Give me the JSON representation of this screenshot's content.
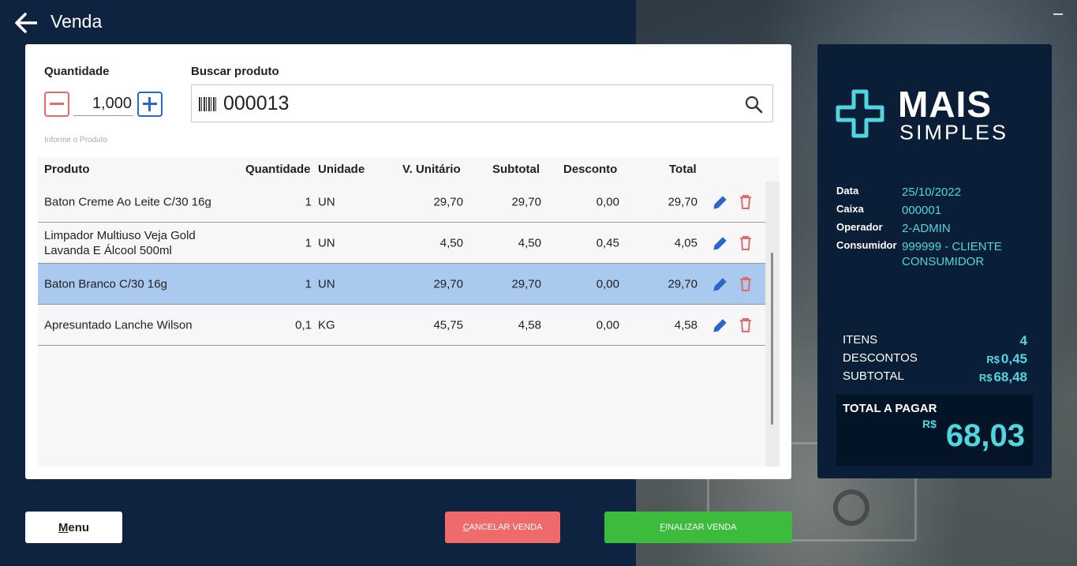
{
  "header": {
    "title": "Venda"
  },
  "quantity": {
    "label": "Quantidade",
    "value": "1,000"
  },
  "search": {
    "label": "Buscar produto",
    "value": "000013",
    "hint": "Informe o Produto"
  },
  "table": {
    "columns": [
      "Produto",
      "Quantidade",
      "Unidade",
      "V. Unitário",
      "Subtotal",
      "Desconto",
      "Total"
    ],
    "rows": [
      {
        "produto": "Baton Creme Ao Leite C/30 16g",
        "quantidade": "1",
        "unidade": "UN",
        "unitario": "29,70",
        "subtotal": "29,70",
        "desconto": "0,00",
        "total": "29,70"
      },
      {
        "produto": "Limpador Multiuso Veja Gold Lavanda E Álcool 500ml",
        "quantidade": "1",
        "unidade": "UN",
        "unitario": "4,50",
        "subtotal": "4,50",
        "desconto": "0,45",
        "total": "4,05"
      },
      {
        "produto": "Baton Branco C/30 16g",
        "quantidade": "1",
        "unidade": "UN",
        "unitario": "29,70",
        "subtotal": "29,70",
        "desconto": "0,00",
        "total": "29,70"
      },
      {
        "produto": "Apresuntado Lanche Wilson",
        "quantidade": "0,1",
        "unidade": "KG",
        "unitario": "45,75",
        "subtotal": "4,58",
        "desconto": "0,00",
        "total": "4,58"
      }
    ],
    "selected_row": 2
  },
  "summary": {
    "logo": {
      "line1": "MAIS",
      "line2": "SIMPLES"
    },
    "info": [
      {
        "label": "Data",
        "value": "25/10/2022"
      },
      {
        "label": "Caixa",
        "value": "000001"
      },
      {
        "label": "Operador",
        "value": "2-ADMIN"
      },
      {
        "label": "Consumidor",
        "value": "999999 - CLIENTE CONSUMIDOR"
      }
    ],
    "totals": {
      "itens_label": "ITENS",
      "itens_value": "4",
      "descontos_label": "DESCONTOS",
      "descontos_currency": "R$",
      "descontos_value": "0,45",
      "subtotal_label": "SUBTOTAL",
      "subtotal_currency": "R$",
      "subtotal_value": "68,48"
    },
    "pay": {
      "label": "TOTAL A PAGAR",
      "currency": "R$",
      "value": "68,03"
    }
  },
  "buttons": {
    "menu": "Menu",
    "cancel": "CANCELAR VENDA",
    "finish": "FINALIZAR VENDA"
  },
  "colors": {
    "accent": "#4fd6df",
    "background": "#0d2340",
    "selected_row": "#a9c9ef",
    "cancel": "#ef6b6b",
    "finish": "#3dbb3d",
    "edit": "#2a67c8",
    "delete": "#e36a6a"
  },
  "icons": {
    "back": "arrow-left-icon",
    "barcode": "barcode-icon",
    "search": "search-icon",
    "edit": "pencil-icon",
    "delete": "trash-icon"
  }
}
